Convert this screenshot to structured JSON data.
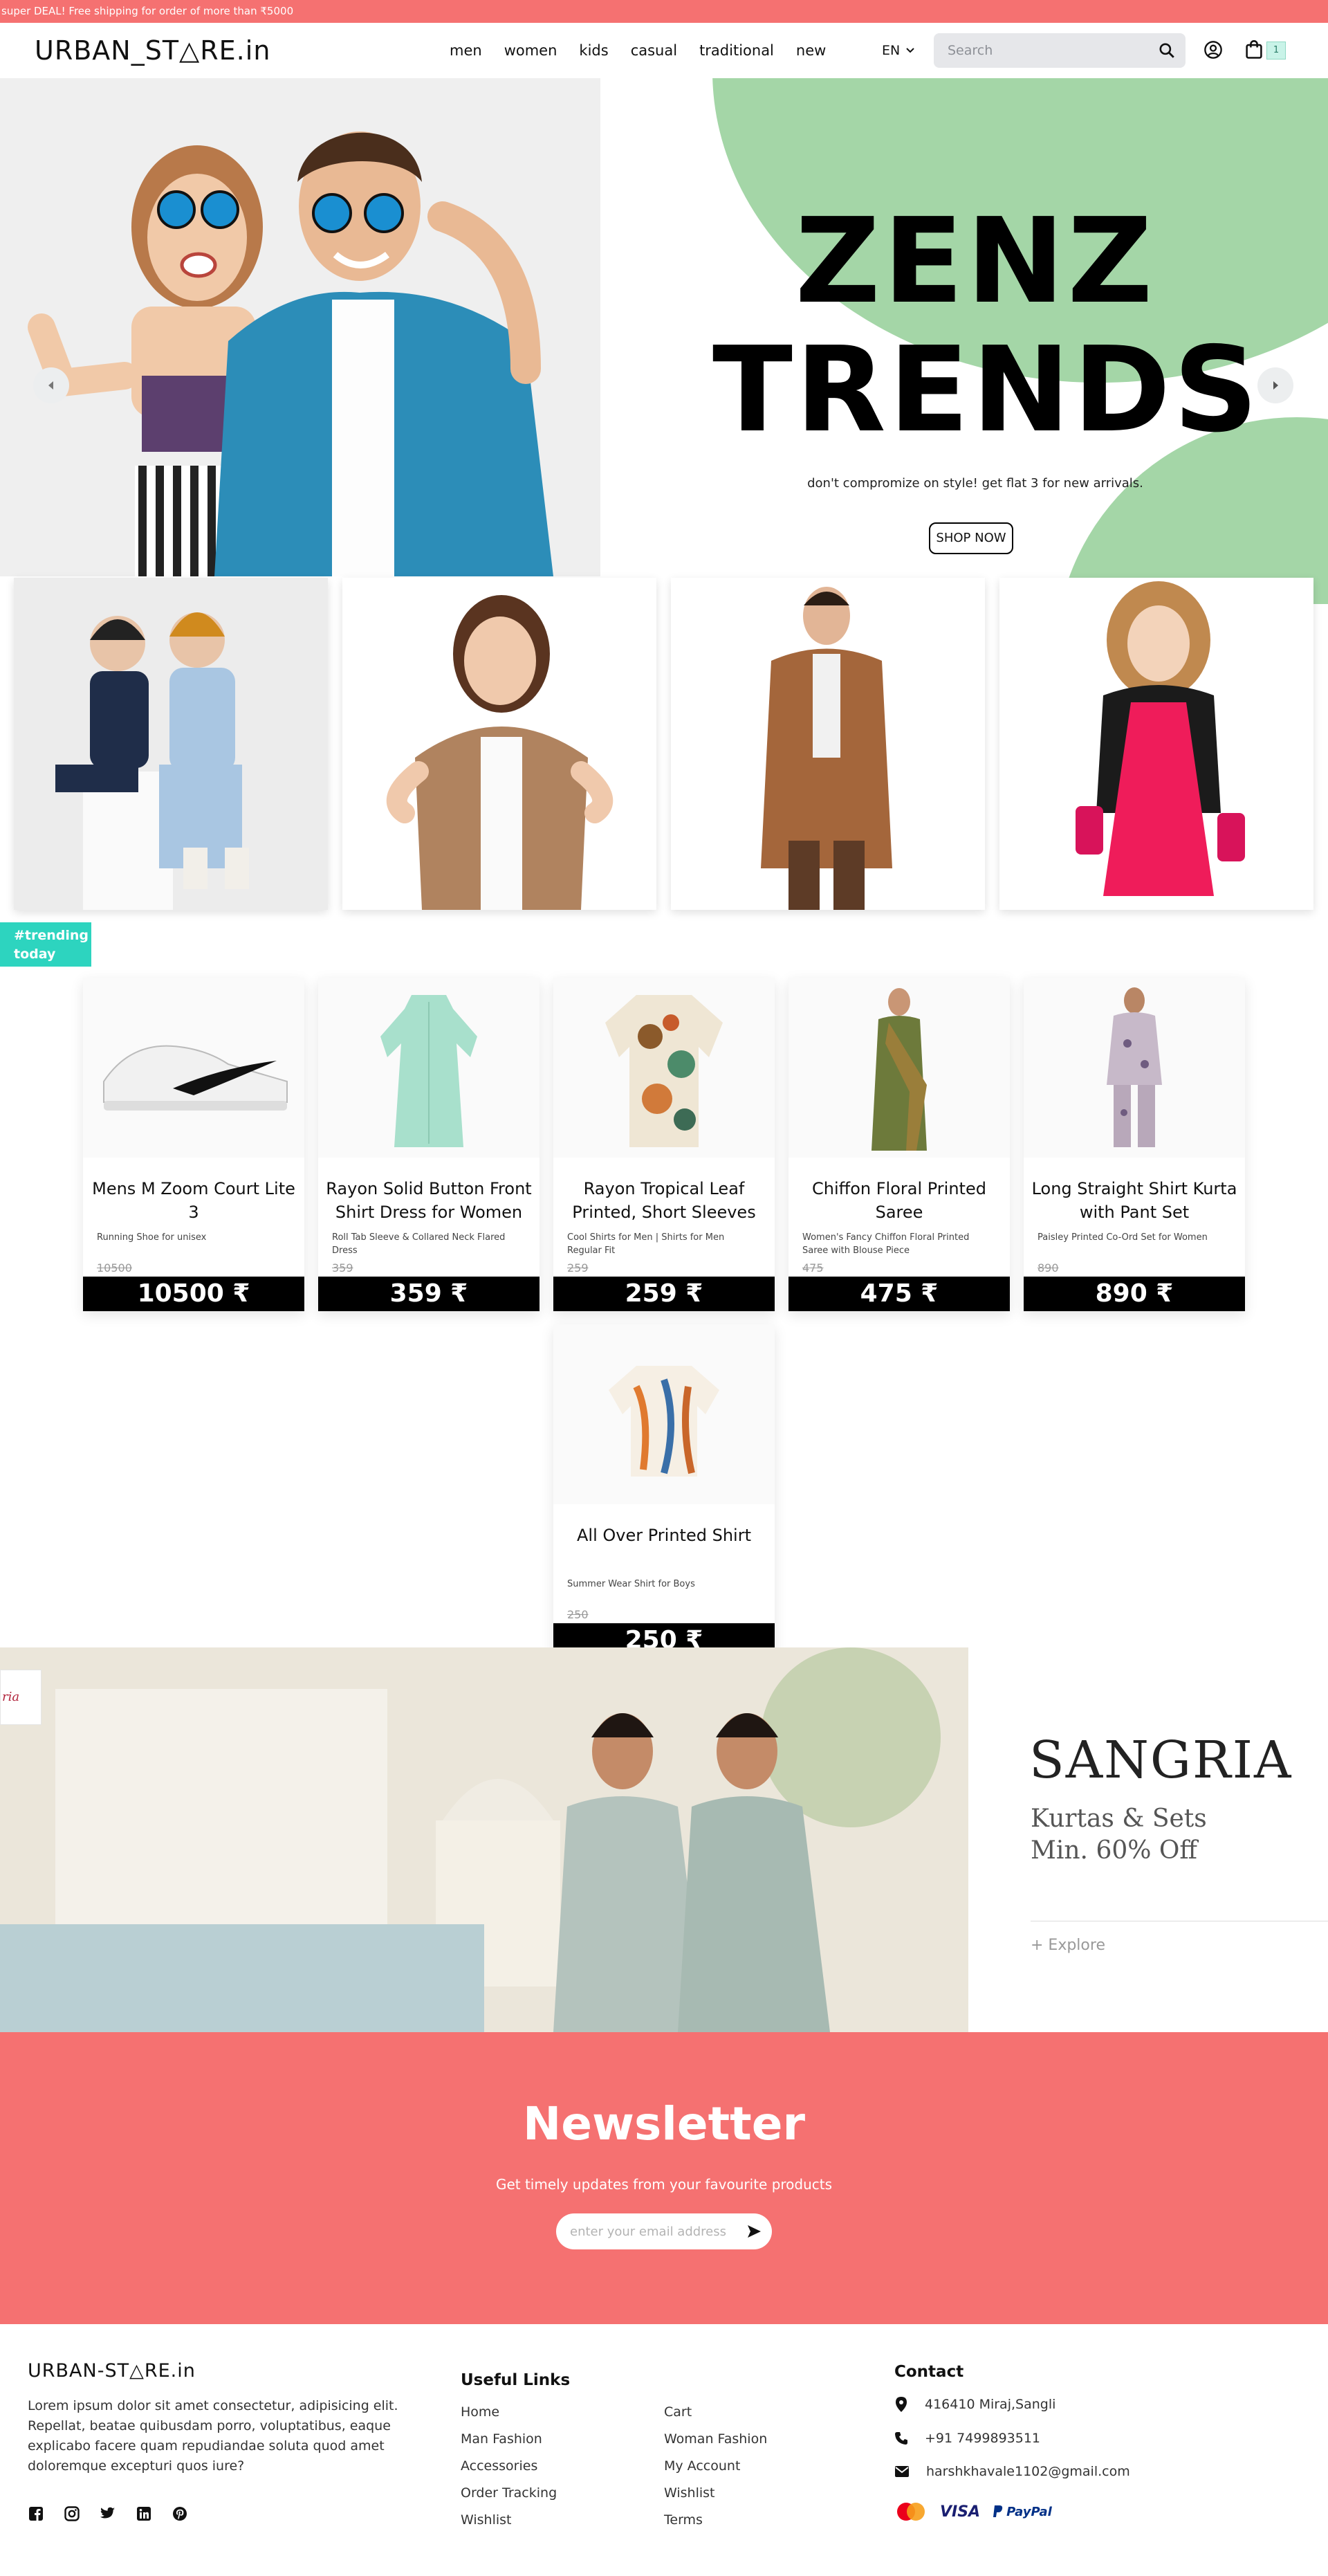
{
  "promo": {
    "text": "super DEAL! Free shipping for order of more than ₹5000"
  },
  "header": {
    "logo": "URBAN_ST△RE.in",
    "nav": [
      "men",
      "women",
      "kids",
      "casual",
      "traditional",
      "new"
    ],
    "language": "EN",
    "search_placeholder": "Search",
    "cart_count": "1"
  },
  "hero": {
    "title_line1": "ZENZ",
    "title_line2": "TRENDS",
    "subtitle": "don't compromize on style! get flat 3 for new arrivals.",
    "cta": "SHOP NOW",
    "accent_color": "#a4d6a7"
  },
  "categories": [
    {
      "name": "kids"
    },
    {
      "name": "women"
    },
    {
      "name": "men"
    },
    {
      "name": "girls"
    }
  ],
  "trending": {
    "tag": "#trending today",
    "products": [
      {
        "name": "Mens M Zoom Court Lite 3",
        "desc": "Running Shoe for unisex",
        "old_price": "10500",
        "price": "10500 ₹"
      },
      {
        "name": "Rayon Solid Button Front Shirt Dress for Women",
        "desc": "Roll Tab Sleeve & Collared Neck Flared Dress",
        "old_price": "359",
        "price": "359 ₹"
      },
      {
        "name": "Rayon Tropical Leaf Printed, Short Sleeves",
        "desc": "Cool Shirts for Men | Shirts for Men Regular Fit",
        "old_price": "259",
        "price": "259 ₹"
      },
      {
        "name": "Chiffon Floral Printed Saree",
        "desc": "Women's Fancy Chiffon Floral Printed Saree with Blouse Piece",
        "old_price": "475",
        "price": "475 ₹"
      },
      {
        "name": "Long Straight Shirt Kurta with Pant Set",
        "desc": "Paisley Printed Co-Ord Set for Women",
        "old_price": "890",
        "price": "890 ₹"
      },
      {
        "name": "All Over Printed Shirt",
        "desc": "Summer Wear Shirt for Boys",
        "old_price": "250",
        "price": "250 ₹"
      }
    ]
  },
  "banner": {
    "logo_text": "ria",
    "title": "SANGRIA",
    "sub_line1": "Kurtas & Sets",
    "sub_line2": "Min. 60% Off",
    "link": "+ Explore"
  },
  "newsletter": {
    "title": "Newsletter",
    "subtitle": "Get timely updates from your favourite products",
    "placeholder": "enter your email address"
  },
  "footer": {
    "logo": "URBAN-ST△RE.in",
    "about": "Lorem ipsum dolor sit amet consectetur, adipisicing elit. Repellat, beatae quibusdam porro, voluptatibus, eaque explicabo facere quam repudiandae soluta quod amet doloremque excepturi quos iure?",
    "useful_links_title": "Useful Links",
    "links_col1": [
      "Home",
      "Man Fashion",
      "Accessories",
      "Order Tracking",
      "Wishlist"
    ],
    "links_col2": [
      "Cart",
      "Woman Fashion",
      "My Account",
      "Wishlist",
      "Terms"
    ],
    "contact_title": "Contact",
    "address": "416410 Miraj,Sangli",
    "phone": "+91 7499893511",
    "email": "harshkhavale1102@gmail.com",
    "payment_visa": "VISA",
    "payment_paypal": "PayPal"
  },
  "colors": {
    "brand": "#f57171",
    "accent": "#2dd4bf",
    "hero_green": "#a4d6a7"
  }
}
